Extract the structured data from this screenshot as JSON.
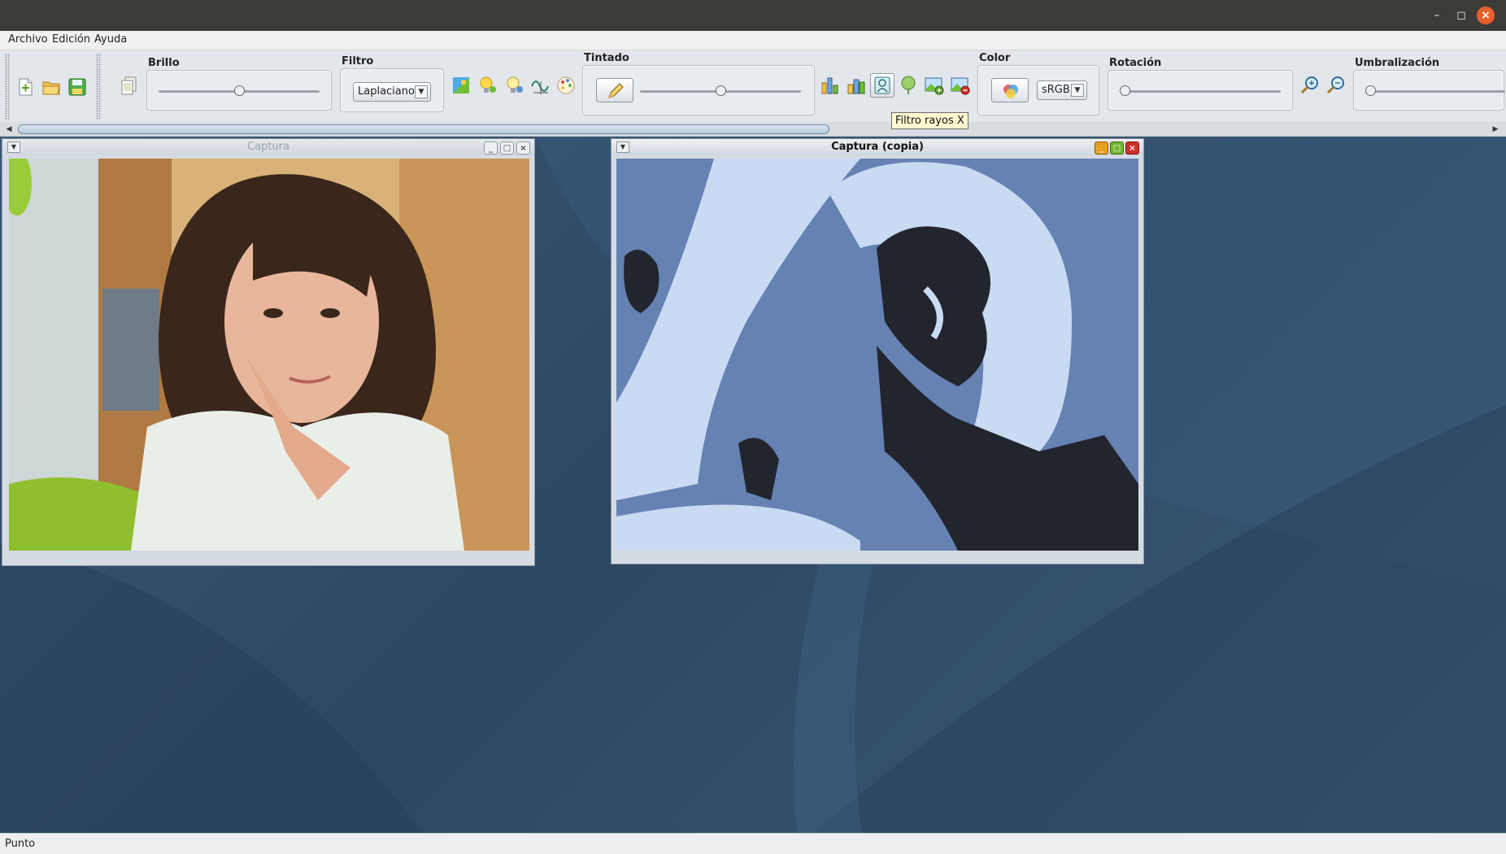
{
  "window": {
    "minimize_glyph": "–",
    "maximize_glyph": "◻",
    "close_glyph": "×"
  },
  "menu": {
    "items": [
      "Archivo",
      "Edición",
      "Ayuda"
    ]
  },
  "toolbar": {
    "file_icons": [
      "new-file-icon",
      "open-folder-icon",
      "save-icon"
    ],
    "duplicate_icon": "duplicate-icon",
    "brillo": {
      "label": "Brillo",
      "value_fraction": 0.5
    },
    "filtro": {
      "label": "Filtro",
      "selected": "Laplaciano"
    },
    "effect_icons": [
      "contrast-icon",
      "bulb-icon",
      "bulb-dark-icon",
      "sine-icon",
      "palette-icon"
    ],
    "tintado": {
      "label": "Tintado",
      "value_fraction": 0.5,
      "button_icon": "pencil-icon"
    },
    "tool_icons": [
      "histogram-icon",
      "equalize-icon",
      "xray-icon",
      "balloon-icon",
      "image-add-icon",
      "image-remove-icon"
    ],
    "color": {
      "label": "Color",
      "button_icon": "color-bands-icon",
      "selected": "sRGB"
    },
    "rotacion": {
      "label": "Rotación",
      "value_fraction": 0.0
    },
    "zoom_icons": [
      "zoom-in-icon",
      "zoom-out-icon"
    ],
    "umbralizacion": {
      "label": "Umbralización",
      "value_fraction": 0.0
    }
  },
  "tooltip": {
    "text": "Filtro rayos X"
  },
  "frames": {
    "captura": {
      "title": "Captura",
      "state": "inactive"
    },
    "copia": {
      "title": "Captura (copia)",
      "state": "active"
    }
  },
  "colors": {
    "desktop": "#2f4a66",
    "xray_dark": "#22252e",
    "xray_mid": "#6582b3",
    "xray_light": "#c9daf3"
  },
  "status": {
    "text": "Punto"
  }
}
